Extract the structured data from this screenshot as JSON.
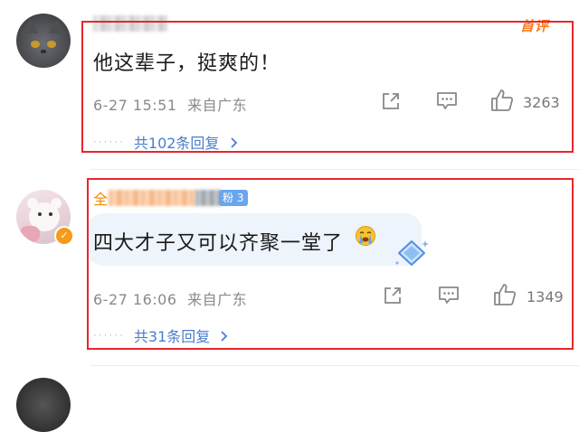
{
  "pinned_label": "首评",
  "comments": [
    {
      "text": "他这辈子，挺爽的！",
      "timestamp": "6-27 15:51",
      "source": "来自广东",
      "like_count": "3263",
      "reply_text": "共102条回复"
    },
    {
      "name_prefix": "全",
      "fan_badge": "粉 3",
      "text": "四大才子又可以齐聚一堂了",
      "timestamp": "6-27 16:06",
      "source": "来自广东",
      "like_count": "1349",
      "reply_text": "共31条回复"
    }
  ],
  "icons": {
    "share": "share-icon",
    "comment": "comment-icon",
    "like": "like-icon",
    "reply_chevron": "chevron-right-icon",
    "emoji": "crying-emoji-icon",
    "decoration": "diamond-sticker-icon",
    "verified": "verified-badge-icon"
  },
  "colors": {
    "highlight_box": "#e8262c",
    "reply_link": "#4a7fc9",
    "pinned": "#ff7a1a",
    "name_orange": "#f08a00",
    "fan_badge": "#6aa6f0",
    "verified_badge": "#f59a1a"
  }
}
